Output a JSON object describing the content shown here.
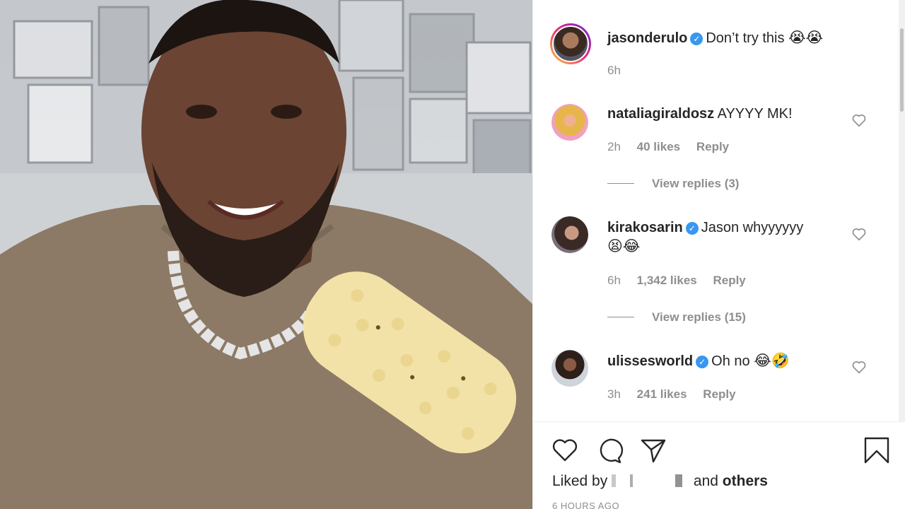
{
  "post": {
    "author": "jasonderulo",
    "caption": "Don’t try this",
    "caption_emoji": "😭😭",
    "time": "6h"
  },
  "comments": [
    {
      "user": "nataliagiraldosz",
      "verified": false,
      "text": "AYYYY MK!",
      "emoji": "",
      "time": "2h",
      "likes": "40 likes",
      "reply": "Reply",
      "view_replies": "View replies (3)"
    },
    {
      "user": "kirakosarin",
      "verified": true,
      "text": "Jason whyyyyyy",
      "emoji": "😫😂",
      "time": "6h",
      "likes": "1,342 likes",
      "reply": "Reply",
      "view_replies": "View replies (15)"
    },
    {
      "user": "ulissesworld",
      "verified": true,
      "text": "Oh no",
      "emoji": "😂🤣",
      "time": "3h",
      "likes": "241 likes",
      "reply": "Reply"
    }
  ],
  "footer": {
    "liked_prefix": "Liked by",
    "liked_and": "and",
    "liked_others": "others",
    "time_ago": "6 HOURS AGO"
  },
  "icons": {
    "like": "heart-icon",
    "comment": "comment-icon",
    "share": "share-icon",
    "save": "bookmark-icon",
    "verified": "verified-badge-icon"
  },
  "colors": {
    "verified_blue": "#3897f0",
    "muted": "#8e8e8e",
    "text": "#262626"
  }
}
